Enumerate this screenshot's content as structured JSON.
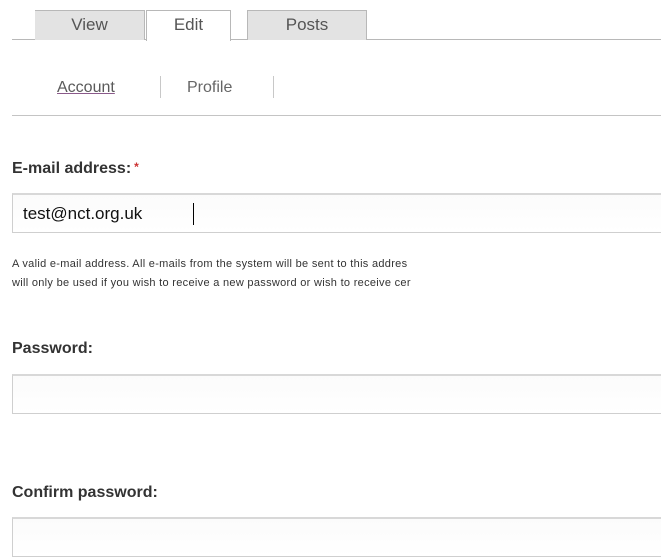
{
  "tabs": {
    "primary": [
      {
        "label": "View"
      },
      {
        "label": "Edit"
      },
      {
        "label": "Posts"
      }
    ],
    "secondary": [
      {
        "label": "Account"
      },
      {
        "label": "Profile"
      }
    ]
  },
  "form": {
    "email": {
      "label": "E-mail address:",
      "required_marker": "*",
      "value": "test@nct.org.uk",
      "description_line1": "A valid e-mail address. All e-mails from the system will be sent to this addres",
      "description_line2": "will only be used if you wish to receive a new password or wish to receive cer"
    },
    "password": {
      "label": "Password:",
      "value": ""
    },
    "confirm_password": {
      "label": "Confirm password:",
      "value": ""
    }
  },
  "colors": {
    "required": "#cc3333",
    "active_tab_underline": "#8a5a8a"
  }
}
